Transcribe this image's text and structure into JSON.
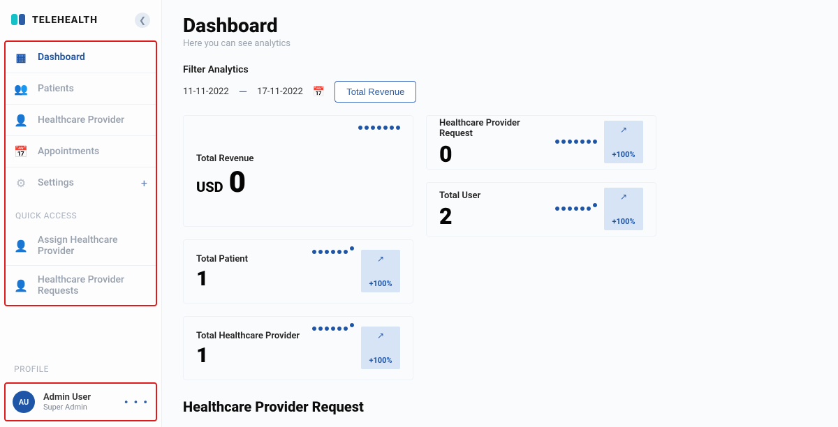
{
  "brand": {
    "name": "TELEHEALTH"
  },
  "sidebar": {
    "items": [
      {
        "icon": "dashboard",
        "label": "Dashboard",
        "active": true
      },
      {
        "icon": "patients",
        "label": "Patients"
      },
      {
        "icon": "provider",
        "label": "Healthcare Provider"
      },
      {
        "icon": "calendar",
        "label": "Appointments"
      },
      {
        "icon": "settings",
        "label": "Settings",
        "plus": true
      }
    ],
    "quick_label": "QUICK ACCESS",
    "quick_items": [
      {
        "label": "Assign Healthcare Provider"
      },
      {
        "label": "Healthcare Provider Requests"
      }
    ],
    "profile_label": "PROFILE",
    "profile": {
      "initials": "AU",
      "name": "Admin User",
      "role": "Super Admin"
    }
  },
  "page": {
    "title": "Dashboard",
    "subtitle": "Here you can see analytics"
  },
  "filter": {
    "label": "Filter Analytics",
    "from": "11-11-2022",
    "to": "17-11-2022",
    "button": "Total Revenue"
  },
  "cards": {
    "revenue": {
      "label": "Total Revenue",
      "unit": "USD",
      "value": "0"
    },
    "hcp_request": {
      "label": "Healthcare Provider Request",
      "value": "0",
      "trend": "+100%"
    },
    "total_user": {
      "label": "Total User",
      "value": "2",
      "trend": "+100%"
    },
    "total_patient": {
      "label": "Total Patient",
      "value": "1",
      "trend": "+100%"
    },
    "total_hcp": {
      "label": "Total Healthcare Provider",
      "value": "1",
      "trend": "+100%"
    }
  },
  "section2": {
    "title": "Healthcare Provider Request"
  }
}
